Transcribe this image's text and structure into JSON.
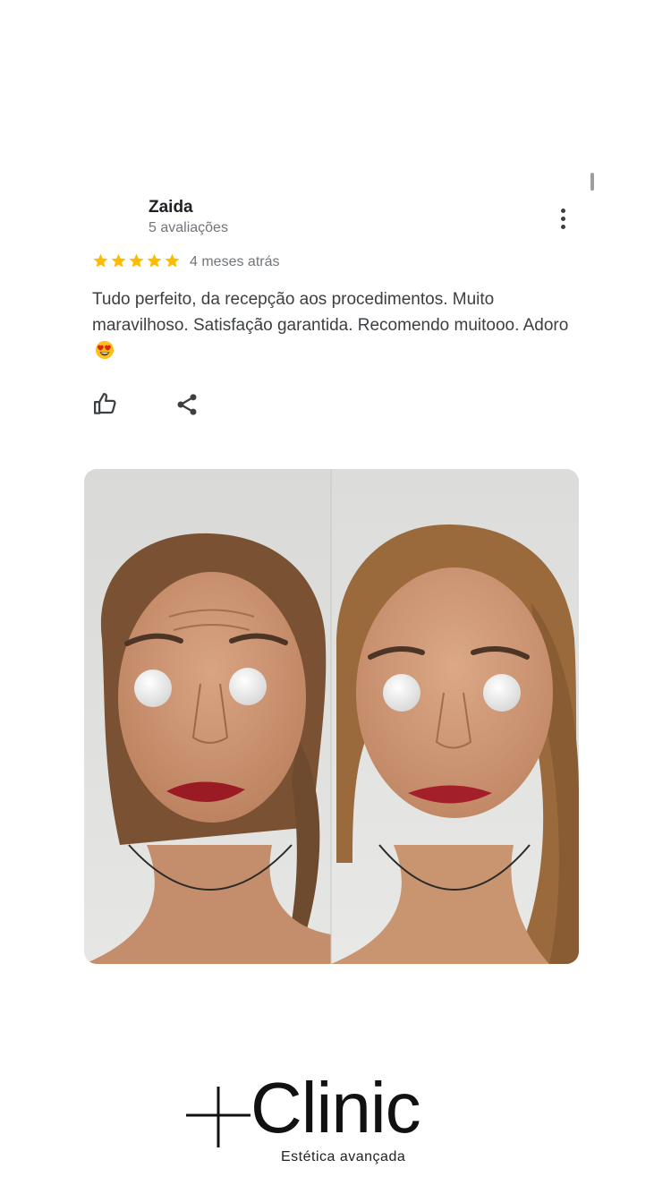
{
  "review": {
    "reviewer_name": "Zaida",
    "reviewer_meta": "5 avaliações",
    "rating": 5,
    "rating_max": 5,
    "date": "4 meses atrás",
    "text": "Tudo perfeito, da recepção aos procedimentos. Muito maravilhoso. Satisfação garantida. Recomendo muitooo. Adoro",
    "emoji": "heart-eyes-emoji",
    "star_color": "#fbbc04",
    "icons": {
      "more": "more-vertical-icon",
      "like": "thumbs-up-icon",
      "share": "share-icon"
    }
  },
  "photo": {
    "subject": "before-after-face-comparison"
  },
  "brand": {
    "name": "Clinic",
    "tagline": "Estética avançada",
    "mark": "plus-icon"
  }
}
